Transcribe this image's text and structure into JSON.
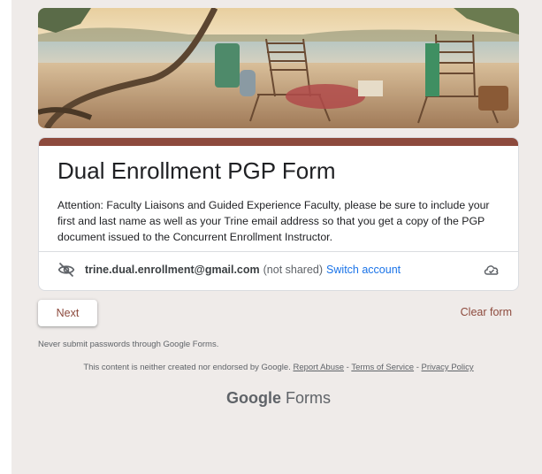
{
  "header": {
    "image_alt": "beach scene with two wooden lounge chairs"
  },
  "form": {
    "title": "Dual Enrollment PGP Form",
    "description": "Attention: Faculty Liaisons and Guided Experience Faculty, please be sure to include your first and last name as well as your Trine email address so that you get a copy of the PGP document issued to the Concurrent Enrollment Instructor.",
    "accent_color": "#8d4a3d"
  },
  "account": {
    "email": "trine.dual.enrollment@gmail.com",
    "shared_note": "(not shared)",
    "switch_label": "Switch account",
    "left_icon": "eye-off-icon",
    "right_icon": "cloud-done-icon"
  },
  "actions": {
    "next_label": "Next",
    "clear_label": "Clear form"
  },
  "footer": {
    "warning": "Never submit passwords through Google Forms.",
    "disclaimer": "This content is neither created nor endorsed by Google.",
    "report_abuse": "Report Abuse",
    "sep1": " - ",
    "terms": "Terms of Service",
    "sep2": " - ",
    "privacy": "Privacy Policy",
    "brand_google": "Google",
    "brand_forms": " Forms"
  },
  "colors": {
    "background": "#efebe9",
    "link": "#1a73e8"
  }
}
